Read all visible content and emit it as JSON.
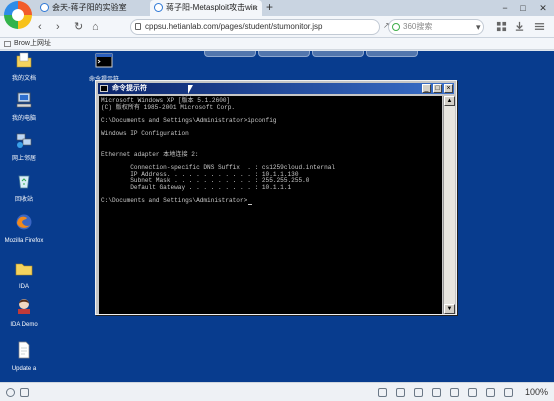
{
  "browser": {
    "tabs": [
      {
        "label": "会天-蒋子阳的实验室"
      },
      {
        "label": "蒋子阳-Metasploit攻击win"
      }
    ],
    "new_tab_glyph": "+",
    "window_controls": [
      "−",
      "□",
      "✕"
    ],
    "nav": {
      "back": "‹",
      "forward": "›",
      "reload": "↻",
      "home": "⌂",
      "expand": "▾"
    },
    "address_url": "cppsu.hetianlab.com/pages/student/stumonitor.jsp",
    "search_placeholder": "360搜索",
    "bookmark_label": "Brow上网址"
  },
  "desktop": {
    "icons": [
      {
        "label": "我的文档",
        "icon": "my-documents-icon"
      },
      {
        "label": "命令提示符",
        "icon": "command-prompt-icon"
      },
      {
        "label": "我的电脑",
        "icon": "my-computer-icon"
      },
      {
        "label": "网上邻居",
        "icon": "network-places-icon"
      },
      {
        "label": "回收站",
        "icon": "recycle-bin-icon"
      },
      {
        "label": "Mozilla Firefox",
        "icon": "firefox-icon"
      },
      {
        "label": "IDA",
        "icon": "ida-folder-icon"
      },
      {
        "label": "IDA Demo",
        "icon": "ida-demo-icon"
      },
      {
        "label": "Update a",
        "icon": "update-file-icon"
      }
    ]
  },
  "cmd": {
    "title": "命令提示符",
    "buttons": {
      "minimize": "_",
      "maximize": "□",
      "close": "×"
    },
    "scroll_up": "▲",
    "scroll_down": "▼",
    "lines": [
      "Microsoft Windows XP [版本 5.1.2600]",
      "(C) 版权所有 1985-2001 Microsoft Corp.",
      "",
      "C:\\Documents and Settings\\Administrator>ipconfig",
      "",
      "Windows IP Configuration",
      "",
      "",
      "Ethernet adapter 本地连接 2:",
      "",
      "        Connection-specific DNS Suffix  . : cs1259cloud.internal",
      "        IP Address. . . . . . . . . . . . : 10.1.1.130",
      "        Subnet Mask . . . . . . . . . . . : 255.255.255.0",
      "        Default Gateway . . . . . . . . . : 10.1.1.1",
      "",
      "C:\\Documents and Settings\\Administrator>"
    ]
  },
  "status": {
    "zoom": "100%"
  },
  "colors": {
    "desktop": "#083c8e",
    "titlebar": "#0b246a",
    "console_bg": "#000000",
    "console_fg": "#c8c8c8"
  }
}
